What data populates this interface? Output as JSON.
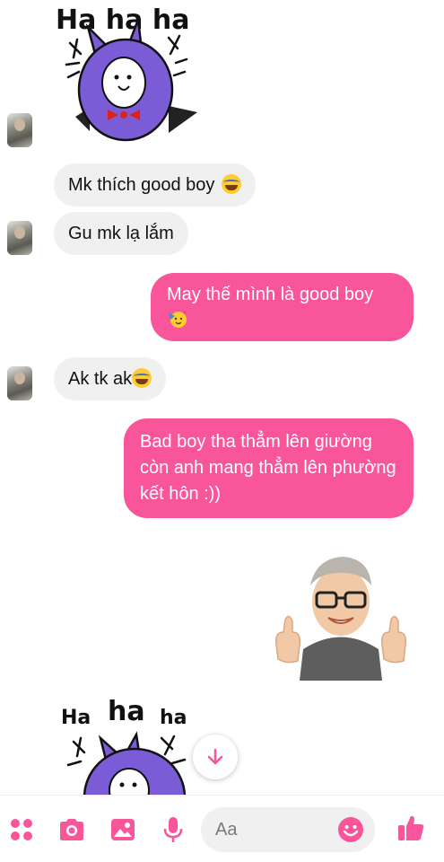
{
  "messages": [
    {
      "type": "sticker",
      "from": "them",
      "name": "ha-ha-ha-sticker",
      "text": "Ha ha ha"
    },
    {
      "type": "text",
      "from": "them",
      "text": "Mk thích good boy",
      "emoji": "tears-of-joy"
    },
    {
      "type": "text",
      "from": "them",
      "text": "Gu mk lạ lắm"
    },
    {
      "type": "text",
      "from": "me",
      "text": "May thế mình là good boy",
      "emoji": "partying-face"
    },
    {
      "type": "text",
      "from": "them",
      "text": "Ak tk ak",
      "emoji": "tears-of-joy"
    },
    {
      "type": "text",
      "from": "me",
      "text": "Bad boy tha thẳm lên giường còn anh mang thẳm lên phường kết hôn :))"
    },
    {
      "type": "sticker",
      "from": "me",
      "name": "memoji-thumbs-up"
    },
    {
      "type": "sticker",
      "from": "them",
      "name": "ha-ha-ha-sticker",
      "text_parts": [
        "Ha",
        "ha",
        "ha"
      ]
    }
  ],
  "composer": {
    "placeholder": "Aa",
    "icons": [
      "grid-dots-icon",
      "camera-icon",
      "image-icon",
      "microphone-icon",
      "emoji-icon",
      "thumbs-up-icon"
    ]
  },
  "colors": {
    "accent": "#f8559a",
    "received_bubble": "#f1f0f0",
    "sticker_purple": "#7b5cd6"
  }
}
